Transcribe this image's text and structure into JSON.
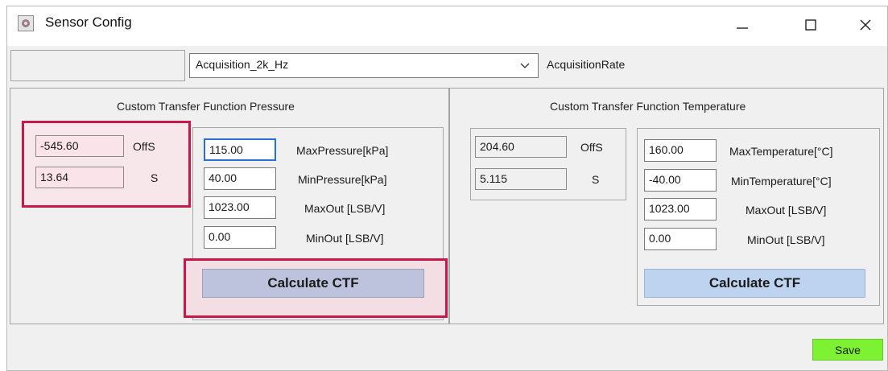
{
  "window": {
    "title": "Sensor Config",
    "icons": {
      "app": "sensor-app-icon",
      "minimize": "minimize-icon",
      "maximize": "maximize-icon",
      "close": "close-icon"
    }
  },
  "acquisition": {
    "selected": "Acquisition_2k_Hz",
    "label": "AcquisitionRate"
  },
  "pressure": {
    "title": "Custom Transfer Function Pressure",
    "offs_value": "-545.60",
    "offs_label": "OffS",
    "s_value": "13.64",
    "s_label": "S",
    "max_pressure": "115.00",
    "max_pressure_label": "MaxPressure[kPa]",
    "min_pressure": "40.00",
    "min_pressure_label": "MinPressure[kPa]",
    "max_out": "1023.00",
    "max_out_label": "MaxOut [LSB/V]",
    "min_out": "0.00",
    "min_out_label": "MinOut [LSB/V]",
    "calc_label": "Calculate CTF"
  },
  "temperature": {
    "title": "Custom Transfer Function Temperature",
    "offs_value": "204.60",
    "offs_label": "OffS",
    "s_value": "5.115",
    "s_label": "S",
    "max_temp": "160.00",
    "max_temp_label": "MaxTemperature[°C]",
    "min_temp": "-40.00",
    "min_temp_label": "MinTemperature[°C]",
    "max_out": "1023.00",
    "max_out_label": "MaxOut [LSB/V]",
    "min_out": "0.00",
    "min_out_label": "MinOut [LSB/V]",
    "calc_label": "Calculate CTF"
  },
  "save_label": "Save",
  "colors": {
    "highlight_border": "#c7184a",
    "pressure_button": "#bec3dd",
    "temperature_button": "#bdd3f0",
    "save_button": "#7df233",
    "readonly_pink": "#fbe4e9"
  }
}
